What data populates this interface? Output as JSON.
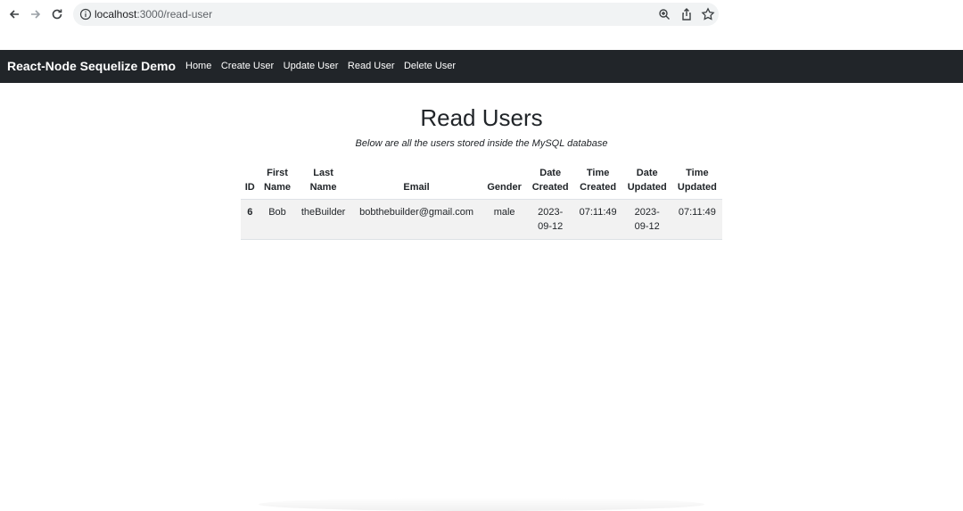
{
  "browser": {
    "url_host": "localhost",
    "url_path": ":3000/read-user"
  },
  "navbar": {
    "brand": "React-Node Sequelize Demo",
    "links": [
      "Home",
      "Create User",
      "Update User",
      "Read User",
      "Delete User"
    ]
  },
  "main": {
    "title": "Read Users",
    "subtitle": "Below are all the users stored inside the MySQL database",
    "table": {
      "headers": {
        "id": "ID",
        "first_name": [
          "First",
          "Name"
        ],
        "last_name": [
          "Last",
          "Name"
        ],
        "email": "Email",
        "gender": "Gender",
        "date_created": [
          "Date",
          "Created"
        ],
        "time_created": [
          "Time",
          "Created"
        ],
        "date_updated": [
          "Date",
          "Updated"
        ],
        "time_updated": [
          "Time",
          "Updated"
        ]
      },
      "rows": [
        {
          "id": "6",
          "first_name": "Bob",
          "last_name": "theBuilder",
          "email": "bobthebuilder@gmail.com",
          "gender": "male",
          "date_created": [
            "2023-",
            "09-12"
          ],
          "time_created": "07:11:49",
          "date_updated": [
            "2023-",
            "09-12"
          ],
          "time_updated": "07:11:49"
        }
      ]
    }
  }
}
